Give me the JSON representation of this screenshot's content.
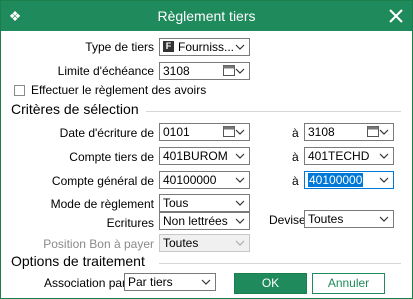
{
  "window": {
    "title": "Règlement tiers"
  },
  "header_fields": {
    "type_tiers": {
      "label": "Type de tiers",
      "badge": "F",
      "value": "Fourniss..."
    },
    "limite": {
      "label": "Limite d'échéance",
      "value": "3108"
    },
    "avoirs": {
      "label": "Effectuer le règlement des avoirs",
      "checked": false
    }
  },
  "criteres": {
    "title": "Critères de sélection",
    "date_ecriture": {
      "label": "Date d'écriture de",
      "from": "0101",
      "to_label": "à",
      "to": "3108"
    },
    "compte_tiers": {
      "label": "Compte tiers de",
      "from": "401BUROM",
      "to_label": "à",
      "to": "401TECHD"
    },
    "compte_general": {
      "label": "Compte général de",
      "from": "40100000",
      "to_label": "à",
      "to": "40100000"
    },
    "mode_reglement": {
      "label": "Mode de règlement",
      "value": "Tous"
    },
    "ecritures": {
      "label": "Ecritures",
      "value": "Non lettrées"
    },
    "devise": {
      "label": "Devise",
      "value": "Toutes"
    },
    "position_bon": {
      "label": "Position Bon à payer",
      "value": "Toutes"
    }
  },
  "options": {
    "title": "Options de traitement",
    "association": {
      "label": "Association par",
      "value": "Par tiers"
    }
  },
  "buttons": {
    "ok": "OK",
    "cancel": "Annuler"
  },
  "colors": {
    "accent": "#1f8a5b",
    "focus": "#0078d7"
  }
}
